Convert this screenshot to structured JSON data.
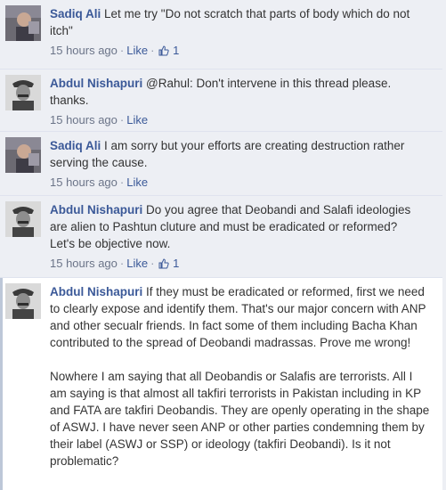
{
  "comments": [
    {
      "author": "Sadiq Ali",
      "text": "Let me try \"Do not scratch that parts of body which do not itch\"",
      "time": "15 hours ago",
      "like_label": "Like",
      "like_count": "1"
    },
    {
      "author": "Abdul Nishapuri",
      "text": "@Rahul: Don't intervene in this thread please. thanks.",
      "time": "15 hours ago",
      "like_label": "Like"
    },
    {
      "author": "Sadiq Ali",
      "text": "I am sorry but your efforts are creating destruction rather serving the cause.",
      "time": "15 hours ago",
      "like_label": "Like"
    },
    {
      "author": "Abdul Nishapuri",
      "text": "Do you agree that Deobandi and Salafi ideologies are alien to Pashtun cluture and must be eradicated or reformed? Let's be objective now.",
      "time": "15 hours ago",
      "like_label": "Like",
      "like_count": "1"
    },
    {
      "author": "Abdul Nishapuri",
      "text": "If they must be eradicated or reformed, first we need to clearly expose and identify them. That's our major concern with ANP and other secualr friends. In fact some of them including Bacha Khan contributed to the spread of Deobandi madrassas. Prove me wrong!",
      "text2": "Nowhere I am saying that all Deobandis or Salafis are terrorists. All I am saying is that almost all takfiri terrorists in Pakistan including in KP and FATA are takfiri Deobandis. They are openly operating in the shape of ASWJ. I have never seen ANP or other parties condemning them by their label (ASWJ or SSP) or ideology (takfiri Deobandi). Is it not problematic?"
    }
  ],
  "colors": {
    "link": "#3b5998",
    "background": "#edeff4"
  }
}
